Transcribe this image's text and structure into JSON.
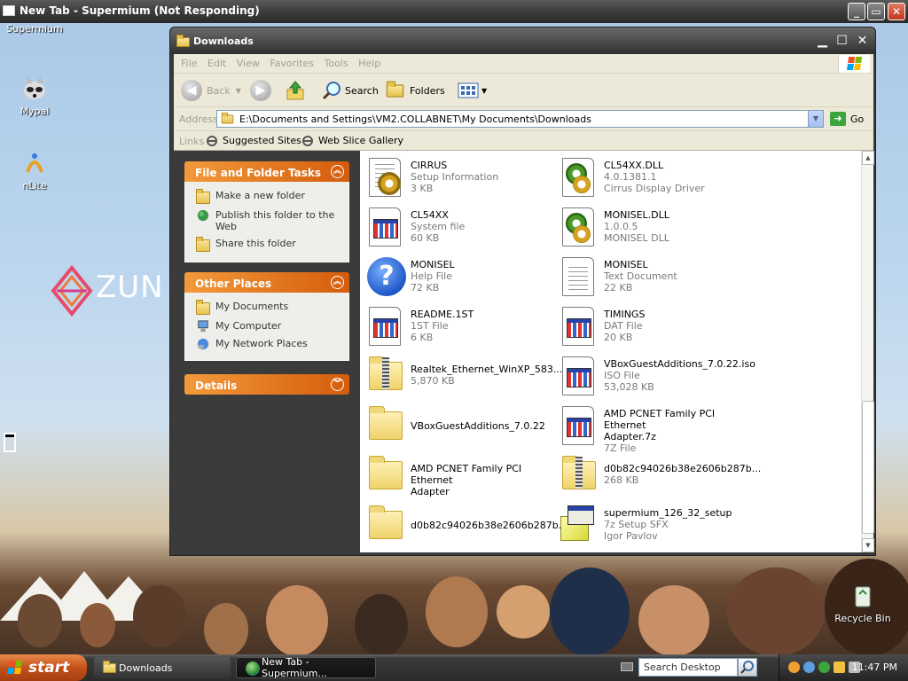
{
  "background_window": {
    "title": "New Tab - Supermium (Not Responding)"
  },
  "desktop": {
    "icons": [
      {
        "label": "Supermium"
      },
      {
        "label": "Mypal"
      },
      {
        "label": "nLite"
      },
      {
        "label": "Recycle Bin"
      }
    ],
    "wallpaper_text": "ZUN"
  },
  "explorer": {
    "title": "Downloads",
    "menu": [
      "File",
      "Edit",
      "View",
      "Favorites",
      "Tools",
      "Help"
    ],
    "toolbar": {
      "back": "Back",
      "search": "Search",
      "folders": "Folders"
    },
    "address": {
      "label": "Address",
      "value": "E:\\Documents and Settings\\VM2.COLLABNET\\My Documents\\Downloads",
      "go": "Go"
    },
    "links": {
      "label": "Links",
      "items": [
        "Suggested Sites",
        "Web Slice Gallery"
      ]
    },
    "tasks": {
      "file_folder": {
        "title": "File and Folder Tasks",
        "items": [
          "Make a new folder",
          "Publish this folder to the Web",
          "Share this folder"
        ]
      },
      "other_places": {
        "title": "Other Places",
        "items": [
          "My Documents",
          "My Computer",
          "My Network Places"
        ]
      },
      "details": {
        "title": "Details"
      }
    },
    "files": [
      {
        "name": "CIRRUS",
        "line2": "Setup Information",
        "line3": "3 KB",
        "icon": "setup-info-icon"
      },
      {
        "name": "CL54XX.DLL",
        "line2": "4.0.1381.1",
        "line3": "Cirrus Display Driver",
        "icon": "dll-icon"
      },
      {
        "name": "CL54XX",
        "line2": "System file",
        "line3": "60 KB",
        "icon": "system-file-icon"
      },
      {
        "name": "MONISEL.DLL",
        "line2": "1.0.0.5",
        "line3": "MONISEL DLL",
        "icon": "dll-icon"
      },
      {
        "name": "MONISEL",
        "line2": "Help File",
        "line3": "72 KB",
        "icon": "help-file-icon"
      },
      {
        "name": "MONISEL",
        "line2": "Text Document",
        "line3": "22 KB",
        "icon": "text-document-icon"
      },
      {
        "name": "README.1ST",
        "line2": "1ST File",
        "line3": "6 KB",
        "icon": "generic-file-icon"
      },
      {
        "name": "TIMINGS",
        "line2": "DAT File",
        "line3": "20 KB",
        "icon": "generic-file-icon"
      },
      {
        "name": "Realtek_Ethernet_WinXP_583...",
        "line2": "5,870 KB",
        "line3": "",
        "icon": "zip-folder-icon"
      },
      {
        "name": "VBoxGuestAdditions_7.0.22.iso",
        "line2": "ISO File",
        "line3": "53,028 KB",
        "icon": "generic-file-icon"
      },
      {
        "name": "VBoxGuestAdditions_7.0.22",
        "line2": "",
        "line3": "",
        "icon": "folder-icon"
      },
      {
        "name": "AMD PCNET Family PCI Ethernet",
        "line2": "Adapter.7z",
        "line3": "7Z File",
        "icon": "generic-file-icon"
      },
      {
        "name": "AMD PCNET Family PCI Ethernet",
        "line2": "Adapter",
        "line3": "",
        "icon": "folder-icon"
      },
      {
        "name": "d0b82c94026b38e2606b287b...",
        "line2": "268 KB",
        "line3": "",
        "icon": "zip-folder-icon"
      },
      {
        "name": "d0b82c94026b38e2606b287b...",
        "line2": "",
        "line3": "",
        "icon": "folder-icon"
      },
      {
        "name": "supermium_126_32_setup",
        "line2": "7z Setup SFX",
        "line3": "Igor Pavlov",
        "icon": "setup-exe-icon"
      }
    ]
  },
  "taskbar": {
    "start": "start",
    "buttons": [
      "Downloads",
      "New Tab - Supermium..."
    ],
    "search_placeholder": "Search Desktop",
    "clock": "11:47 PM"
  }
}
